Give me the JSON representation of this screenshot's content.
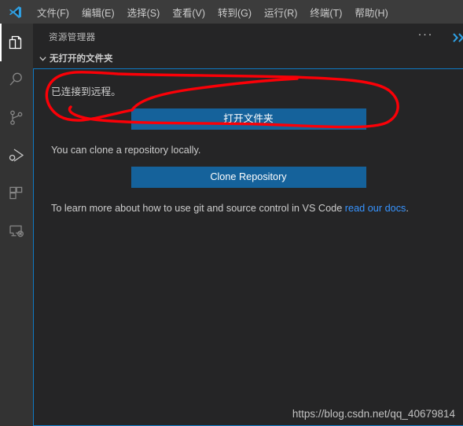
{
  "window": {
    "logo_icon": "vscode-logo-icon"
  },
  "menubar": {
    "items": [
      {
        "label": "文件(F)",
        "name": "menu-file"
      },
      {
        "label": "编辑(E)",
        "name": "menu-edit"
      },
      {
        "label": "选择(S)",
        "name": "menu-selection"
      },
      {
        "label": "查看(V)",
        "name": "menu-view"
      },
      {
        "label": "转到(G)",
        "name": "menu-go"
      },
      {
        "label": "运行(R)",
        "name": "menu-run"
      },
      {
        "label": "终端(T)",
        "name": "menu-terminal"
      },
      {
        "label": "帮助(H)",
        "name": "menu-help"
      }
    ]
  },
  "activitybar": {
    "items": [
      {
        "icon": "explorer-files-icon",
        "active": true
      },
      {
        "icon": "search-icon",
        "active": false
      },
      {
        "icon": "source-control-branch-icon",
        "active": false
      },
      {
        "icon": "run-and-debug-icon",
        "active": false
      },
      {
        "icon": "extensions-blocks-icon",
        "active": false
      },
      {
        "icon": "remote-explorer-monitor-icon",
        "active": false
      }
    ]
  },
  "sidebar": {
    "title": "资源管理器",
    "more_actions_label": "···",
    "more_actions_icon": "ellipsis-icon",
    "collapse_icon": "chevron-right-icon",
    "section": {
      "twisty_icon": "chevron-down-icon",
      "header": "无打开的文件夹"
    }
  },
  "welcome": {
    "remote_status_text": "已连接到远程。",
    "open_folder_button": "打开文件夹",
    "clone_text": "You can clone a repository locally.",
    "clone_button": "Clone Repository",
    "docs_text_before": "To learn more about how to use git and source control in VS Code ",
    "docs_link": "read our docs",
    "docs_text_after": "."
  },
  "annotation": {
    "type": "hand-drawn-red-loop",
    "color": "#fb0007"
  },
  "watermark": {
    "text": "https://blog.csdn.net/qq_40679814"
  },
  "colors": {
    "titlebar_bg": "#3c3c3c",
    "activitybar_bg": "#333333",
    "sidebar_bg": "#252526",
    "button_blue": "#15629b",
    "focus_border": "#0e7ac4",
    "link_blue": "#3794ff",
    "annotation_red": "#fb0007"
  }
}
